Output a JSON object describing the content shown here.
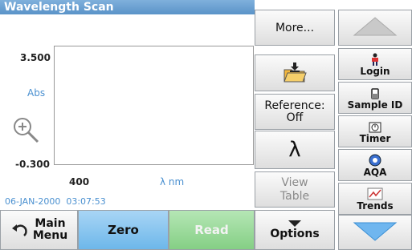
{
  "header": {
    "title": "Wavelength Scan"
  },
  "graph": {
    "y_max": "3.500",
    "y_min": "-0.300",
    "y_unit": "Abs",
    "x_min": "400",
    "x_unit": "λ nm"
  },
  "timestamp": "06-JAN-2000  03:07:53",
  "right_panel": {
    "more": "More...",
    "reference": "Reference:\nOff",
    "lambda": "λ",
    "view_table": "View\nTable",
    "options": "Options"
  },
  "sidebar": {
    "login": "Login",
    "sample_id": "Sample ID",
    "timer": "Timer",
    "aqa": "AQA",
    "trends": "Trends"
  },
  "bottom": {
    "main_menu": "Main\nMenu",
    "zero": "Zero",
    "read": "Read"
  }
}
